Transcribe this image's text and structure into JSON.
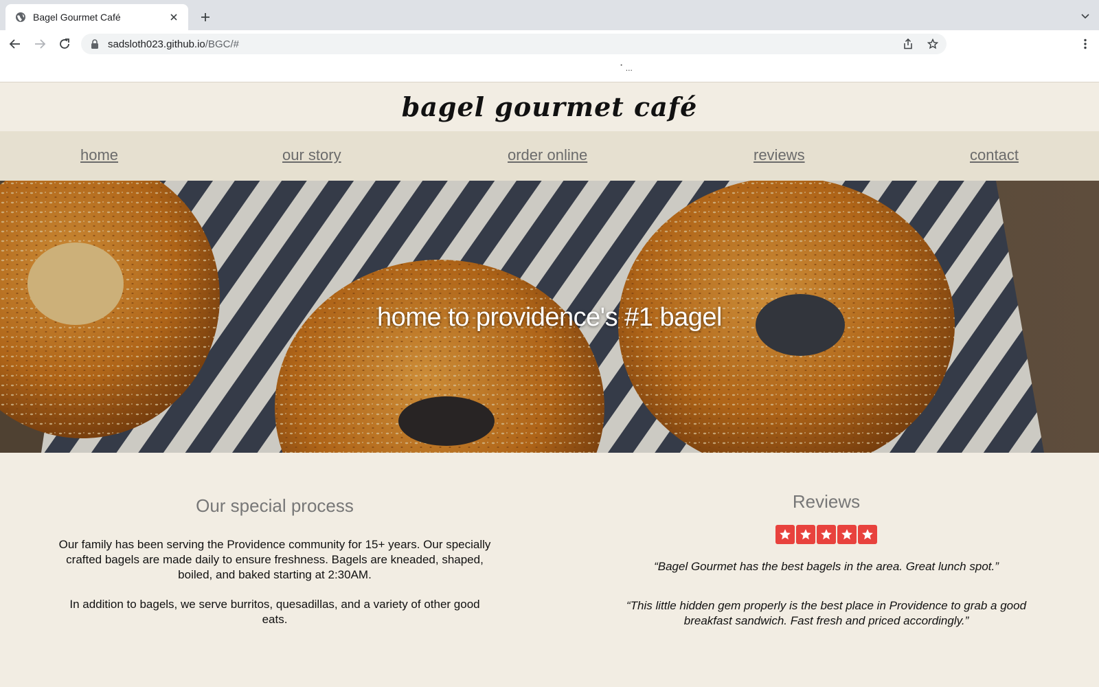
{
  "browser": {
    "tab": {
      "title": "Bagel Gourmet Café",
      "favicon": "globe-icon"
    },
    "address": {
      "host": "sadsloth023.github.io",
      "path": "/BGC/#"
    },
    "loading_indicator": "⠁..."
  },
  "site": {
    "brand": "bagel gourmet café",
    "nav": [
      {
        "label": "home"
      },
      {
        "label": "our story"
      },
      {
        "label": "order online"
      },
      {
        "label": "reviews"
      },
      {
        "label": "contact"
      }
    ],
    "hero": {
      "title": "home to providence's #1 bagel"
    },
    "process": {
      "heading": "Our special process",
      "paragraphs": [
        "Our family has been serving the Providence community for 15+ years. Our specially crafted bagels are made daily to ensure freshness. Bagels are kneaded, shaped, boiled, and baked starting at 2:30AM.",
        "In addition to bagels, we serve burritos, quesadillas, and a variety of other good eats."
      ]
    },
    "reviews": {
      "heading": "Reviews",
      "rating": 5,
      "rating_max": 5,
      "star_color": "#e8423d",
      "quotes": [
        "“Bagel Gourmet has the best bagels in the area. Great lunch spot.”",
        "“This little hidden gem properly is the best place in Providence to grab a good breakfast sandwich. Fast fresh and priced accordingly.”"
      ]
    }
  },
  "colors": {
    "page_background": "#f2ede3",
    "nav_background": "#e6e0d0",
    "nav_link": "#6b6b6b",
    "heading_gray": "#777777"
  }
}
